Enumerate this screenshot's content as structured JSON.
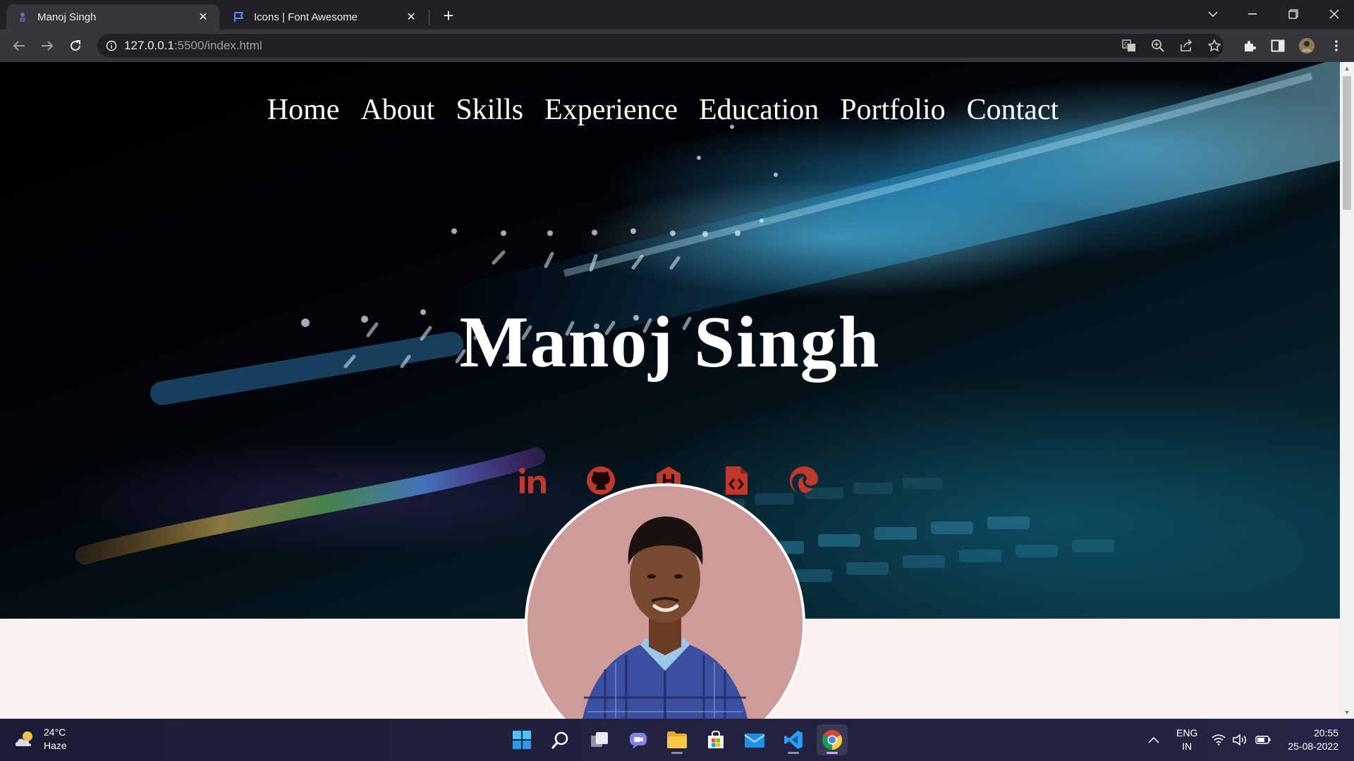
{
  "browser": {
    "tabs": [
      {
        "title": "Manoj Singh",
        "active": true,
        "favicon": "avatar-favicon"
      },
      {
        "title": "Icons | Font Awesome",
        "active": false,
        "favicon": "flag-favicon"
      }
    ],
    "url_host": "127.0.0.1",
    "url_path": ":5500/index.html"
  },
  "page": {
    "nav": [
      "Home",
      "About",
      "Skills",
      "Experience",
      "Education",
      "Portfolio",
      "Contact"
    ],
    "name": "Manoj Singh",
    "socials": [
      {
        "name": "linkedin-icon",
        "glyph": "in"
      },
      {
        "name": "github-icon"
      },
      {
        "name": "hashnode-icon",
        "glyph": "H"
      },
      {
        "name": "file-code-icon"
      },
      {
        "name": "edge-icon"
      }
    ],
    "accent": "#c0392b"
  },
  "taskbar": {
    "weather_temp": "24°C",
    "weather_desc": "Haze",
    "lang_top": "ENG",
    "lang_bottom": "IN",
    "time": "20:55",
    "date": "25-08-2022"
  }
}
